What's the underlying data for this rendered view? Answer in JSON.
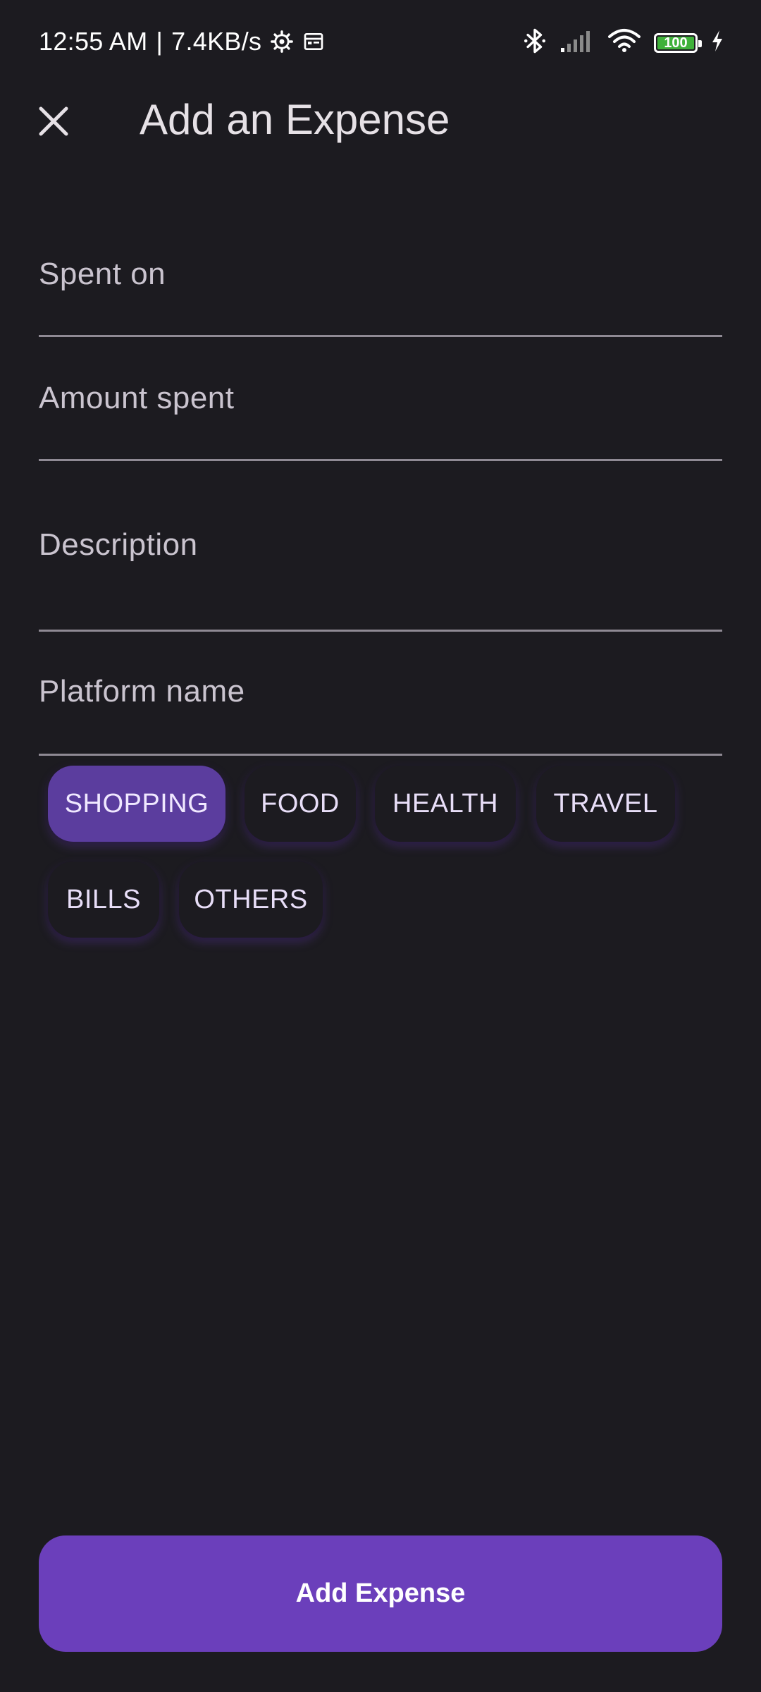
{
  "status_bar": {
    "time": "12:55 AM",
    "separator": "|",
    "speed": "7.4KB/s",
    "battery_level": "100",
    "battery_color": "#3fb13a",
    "icons": [
      "settings-gear-icon",
      "calendar-icon",
      "bluetooth-icon",
      "cell-signal-icon",
      "wifi-icon",
      "battery-icon",
      "charging-bolt-icon"
    ]
  },
  "app_bar": {
    "close_icon": "close-icon",
    "title": "Add an Expense"
  },
  "form": {
    "spent_on_label": "Spent on",
    "amount_label": "Amount spent",
    "description_label": "Description",
    "platform_label": "Platform name"
  },
  "categories": {
    "selected": "SHOPPING",
    "items": [
      "SHOPPING",
      "FOOD",
      "HEALTH",
      "TRAVEL",
      "BILLS",
      "OTHERS"
    ]
  },
  "actions": {
    "add_expense_label": "Add Expense"
  },
  "colors": {
    "background": "#1c1b20",
    "accent": "#6b3fbb",
    "selected_chip": "#5b3d9e"
  }
}
